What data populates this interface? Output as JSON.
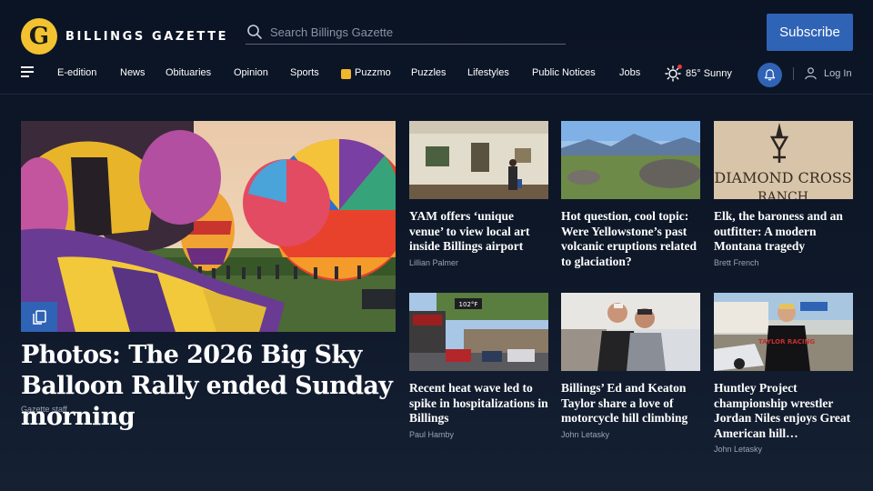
{
  "header": {
    "logo_letter": "G",
    "logo_text": "BILLINGS GAZETTE",
    "search_placeholder": "Search Billings Gazette",
    "subscribe_label": "Subscribe"
  },
  "nav": {
    "items": [
      "E-edition",
      "News",
      "Obituaries",
      "Opinion",
      "Sports",
      "Puzzmo",
      "Puzzles",
      "Lifestyles",
      "Public Notices",
      "Jobs"
    ],
    "weather": "85° Sunny",
    "login_label": "Log In"
  },
  "hero": {
    "title": "Photos: The 2026 Big Sky Balloon Rally ended Sunday morning",
    "byline": "Gazette staff"
  },
  "cards": [
    {
      "headline": "YAM offers ‘unique venue’ to view local art inside Billings airport",
      "byline": "Lillian Palmer"
    },
    {
      "headline": "Hot question, cool topic: Were Yellowstone’s past volcanic eruptions related to glaciation?",
      "byline": ""
    },
    {
      "headline": "Elk, the baroness and an outfitter: A modern Montana tragedy",
      "byline": "Brett French"
    },
    {
      "headline": "Recent heat wave led to spike in hospitalizations in Billings",
      "byline": "Paul Hamby"
    },
    {
      "headline": "Billings’ Ed and Keaton Taylor share a love of motorcycle hill climbing",
      "byline": "John Letasky"
    },
    {
      "headline": "Huntley Project championship wrestler Jordan Niles enjoys Great American hill…",
      "byline": "John Letasky"
    }
  ],
  "photo_text": {
    "thermometer": "102°F",
    "brand_sign_line1": "DIAMOND CROSS",
    "brand_sign_line2": "RANCH",
    "shirt": "TAYLOR RACING"
  },
  "colors": {
    "accent": "#2f63b6",
    "logo": "#f2c230",
    "background": "#0e1829",
    "notification_dot": "#e53b3b"
  },
  "icons": [
    "logo-g-icon",
    "search-icon",
    "hamburger-menu-icon",
    "puzzmo-icon",
    "sun-icon",
    "bell-icon",
    "user-icon",
    "gallery-icon"
  ]
}
